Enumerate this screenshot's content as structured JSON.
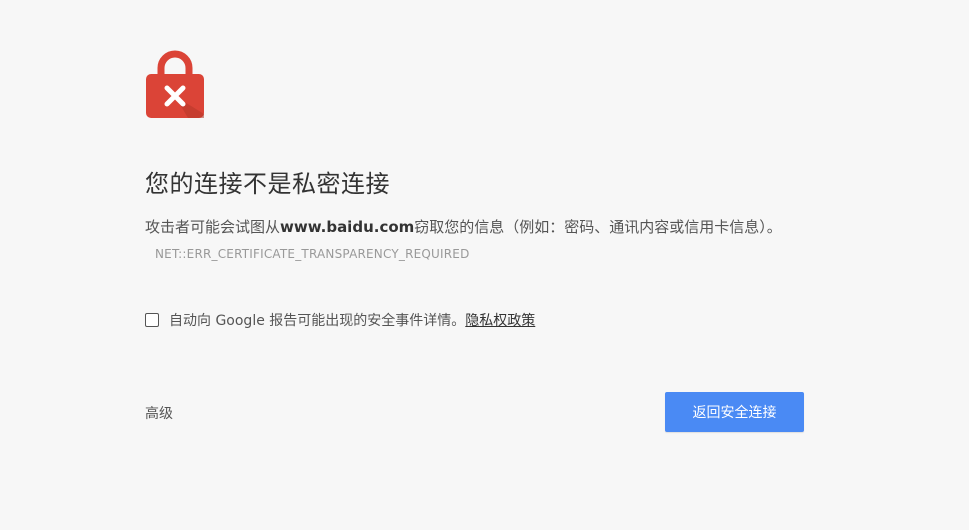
{
  "icon": {
    "name": "lock-error-icon",
    "color": "#db4437"
  },
  "heading": "您的连接不是私密连接",
  "description": {
    "prefix": "攻击者可能会试图从",
    "domain": "www.baidu.com",
    "suffix": "窃取您的信息（例如：密码、通讯内容或信用卡信息）。",
    "error_code": "NET::ERR_CERTIFICATE_TRANSPARENCY_REQUIRED"
  },
  "report": {
    "label": "自动向 Google 报告可能出现的安全事件详情。",
    "privacy_link": "隐私权政策"
  },
  "advanced_label": "高级",
  "back_button_label": "返回安全连接",
  "colors": {
    "background": "#f7f7f7",
    "button": "#4a8af4"
  }
}
